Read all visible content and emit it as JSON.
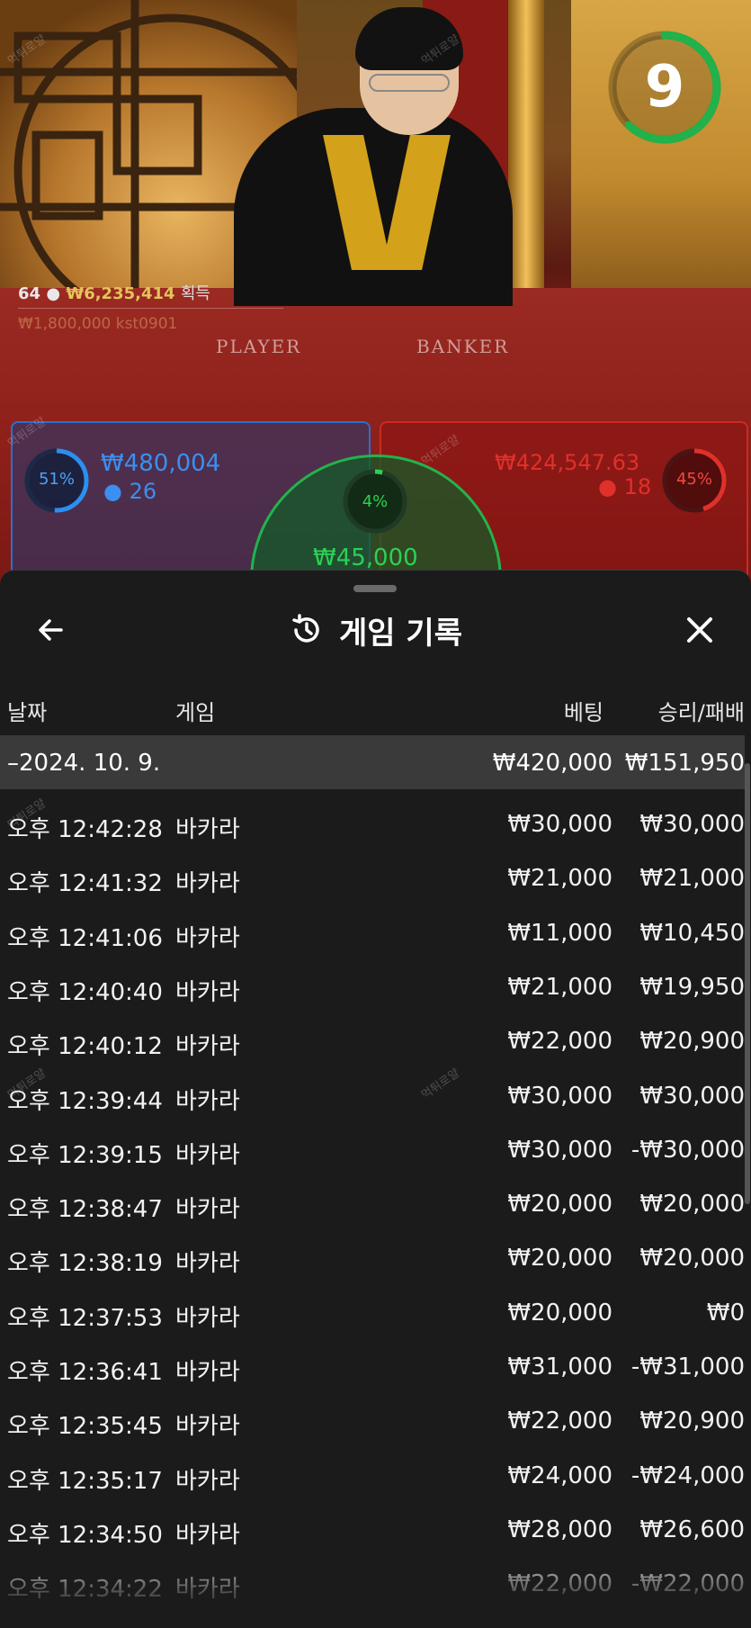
{
  "video": {
    "table_labels": {
      "player": "PLAYER",
      "banker": "BANKER"
    },
    "countdown": "9",
    "countdown_fraction": 0.62,
    "winners": {
      "count": "64",
      "amount": "₩6,235,414",
      "label": "획득"
    },
    "win_sub": "₩1,800,000 kst0901",
    "player_bet": {
      "percent": "51%",
      "percent_value": 0.51,
      "amount": "₩480,004",
      "count": "26"
    },
    "banker_bet": {
      "percent": "45%",
      "percent_value": 0.45,
      "amount": "₩424,547.63",
      "count": "18"
    },
    "tie_bet": {
      "percent": "4%",
      "percent_value": 0.04,
      "amount": "₩45,000"
    },
    "watermark": "먹튀로얄"
  },
  "sheet": {
    "title": "게임 기록",
    "back_icon": "arrow-left-icon",
    "history_icon": "history-clock-icon",
    "close_icon": "close-icon",
    "columns": {
      "date": "날짜",
      "game": "게임",
      "bet": "베팅",
      "winloss": "승리/패배"
    },
    "date_group": {
      "date": "–2024. 10. 9.",
      "bet": "₩420,000",
      "winloss": "₩151,950"
    },
    "rows": [
      {
        "time": "오후 12:42:28",
        "game": "바카라",
        "bet": "₩30,000",
        "winloss": "₩30,000"
      },
      {
        "time": "오후 12:41:32",
        "game": "바카라",
        "bet": "₩21,000",
        "winloss": "₩21,000"
      },
      {
        "time": "오후 12:41:06",
        "game": "바카라",
        "bet": "₩11,000",
        "winloss": "₩10,450"
      },
      {
        "time": "오후 12:40:40",
        "game": "바카라",
        "bet": "₩21,000",
        "winloss": "₩19,950"
      },
      {
        "time": "오후 12:40:12",
        "game": "바카라",
        "bet": "₩22,000",
        "winloss": "₩20,900"
      },
      {
        "time": "오후 12:39:44",
        "game": "바카라",
        "bet": "₩30,000",
        "winloss": "₩30,000"
      },
      {
        "time": "오후 12:39:15",
        "game": "바카라",
        "bet": "₩30,000",
        "winloss": "-₩30,000"
      },
      {
        "time": "오후 12:38:47",
        "game": "바카라",
        "bet": "₩20,000",
        "winloss": "₩20,000"
      },
      {
        "time": "오후 12:38:19",
        "game": "바카라",
        "bet": "₩20,000",
        "winloss": "₩20,000"
      },
      {
        "time": "오후 12:37:53",
        "game": "바카라",
        "bet": "₩20,000",
        "winloss": "₩0"
      },
      {
        "time": "오후 12:36:41",
        "game": "바카라",
        "bet": "₩31,000",
        "winloss": "-₩31,000"
      },
      {
        "time": "오후 12:35:45",
        "game": "바카라",
        "bet": "₩22,000",
        "winloss": "₩20,900"
      },
      {
        "time": "오후 12:35:17",
        "game": "바카라",
        "bet": "₩24,000",
        "winloss": "-₩24,000"
      },
      {
        "time": "오후 12:34:50",
        "game": "바카라",
        "bet": "₩28,000",
        "winloss": "₩26,600"
      },
      {
        "time": "오후 12:34:22",
        "game": "바카라",
        "bet": "₩22,000",
        "winloss": "-₩22,000"
      }
    ]
  },
  "colors": {
    "player_blue": "#2b6fd1",
    "banker_red": "#cc2a22",
    "tie_green": "#23b34a",
    "gold": "#e3c45a",
    "sheet_bg": "#1b1b1b",
    "date_row_bg": "#3a3a3a"
  }
}
